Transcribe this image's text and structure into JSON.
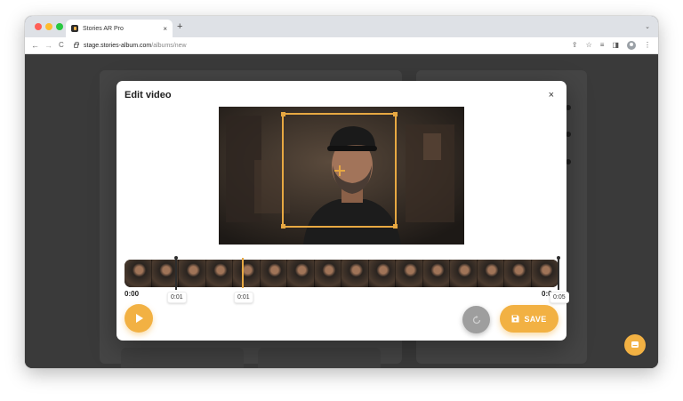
{
  "browser": {
    "tab_title": "Stories AR Pro",
    "tab_close": "×",
    "new_tab": "+",
    "url_domain": "stage.stories-album.com",
    "url_path": "/albums/new",
    "nav": {
      "back": "←",
      "forward": "→",
      "reload": "C"
    }
  },
  "modal": {
    "title": "Edit video",
    "close": "×"
  },
  "timeline": {
    "start_time": "0:00",
    "end_time": "0:05",
    "end_label_partial": "0:0",
    "trim_start": "0:01",
    "playhead": "0:01",
    "trim_end": "0:05",
    "thumbnail_count": 16
  },
  "controls": {
    "save_label": "SAVE",
    "play_icon": "play-icon",
    "reset_icon": "reset-icon",
    "save_icon": "floppy-disk-icon"
  },
  "colors": {
    "accent": "#f2b143",
    "crop_border": "#e7a842",
    "backdrop": "#3a3a3a"
  }
}
